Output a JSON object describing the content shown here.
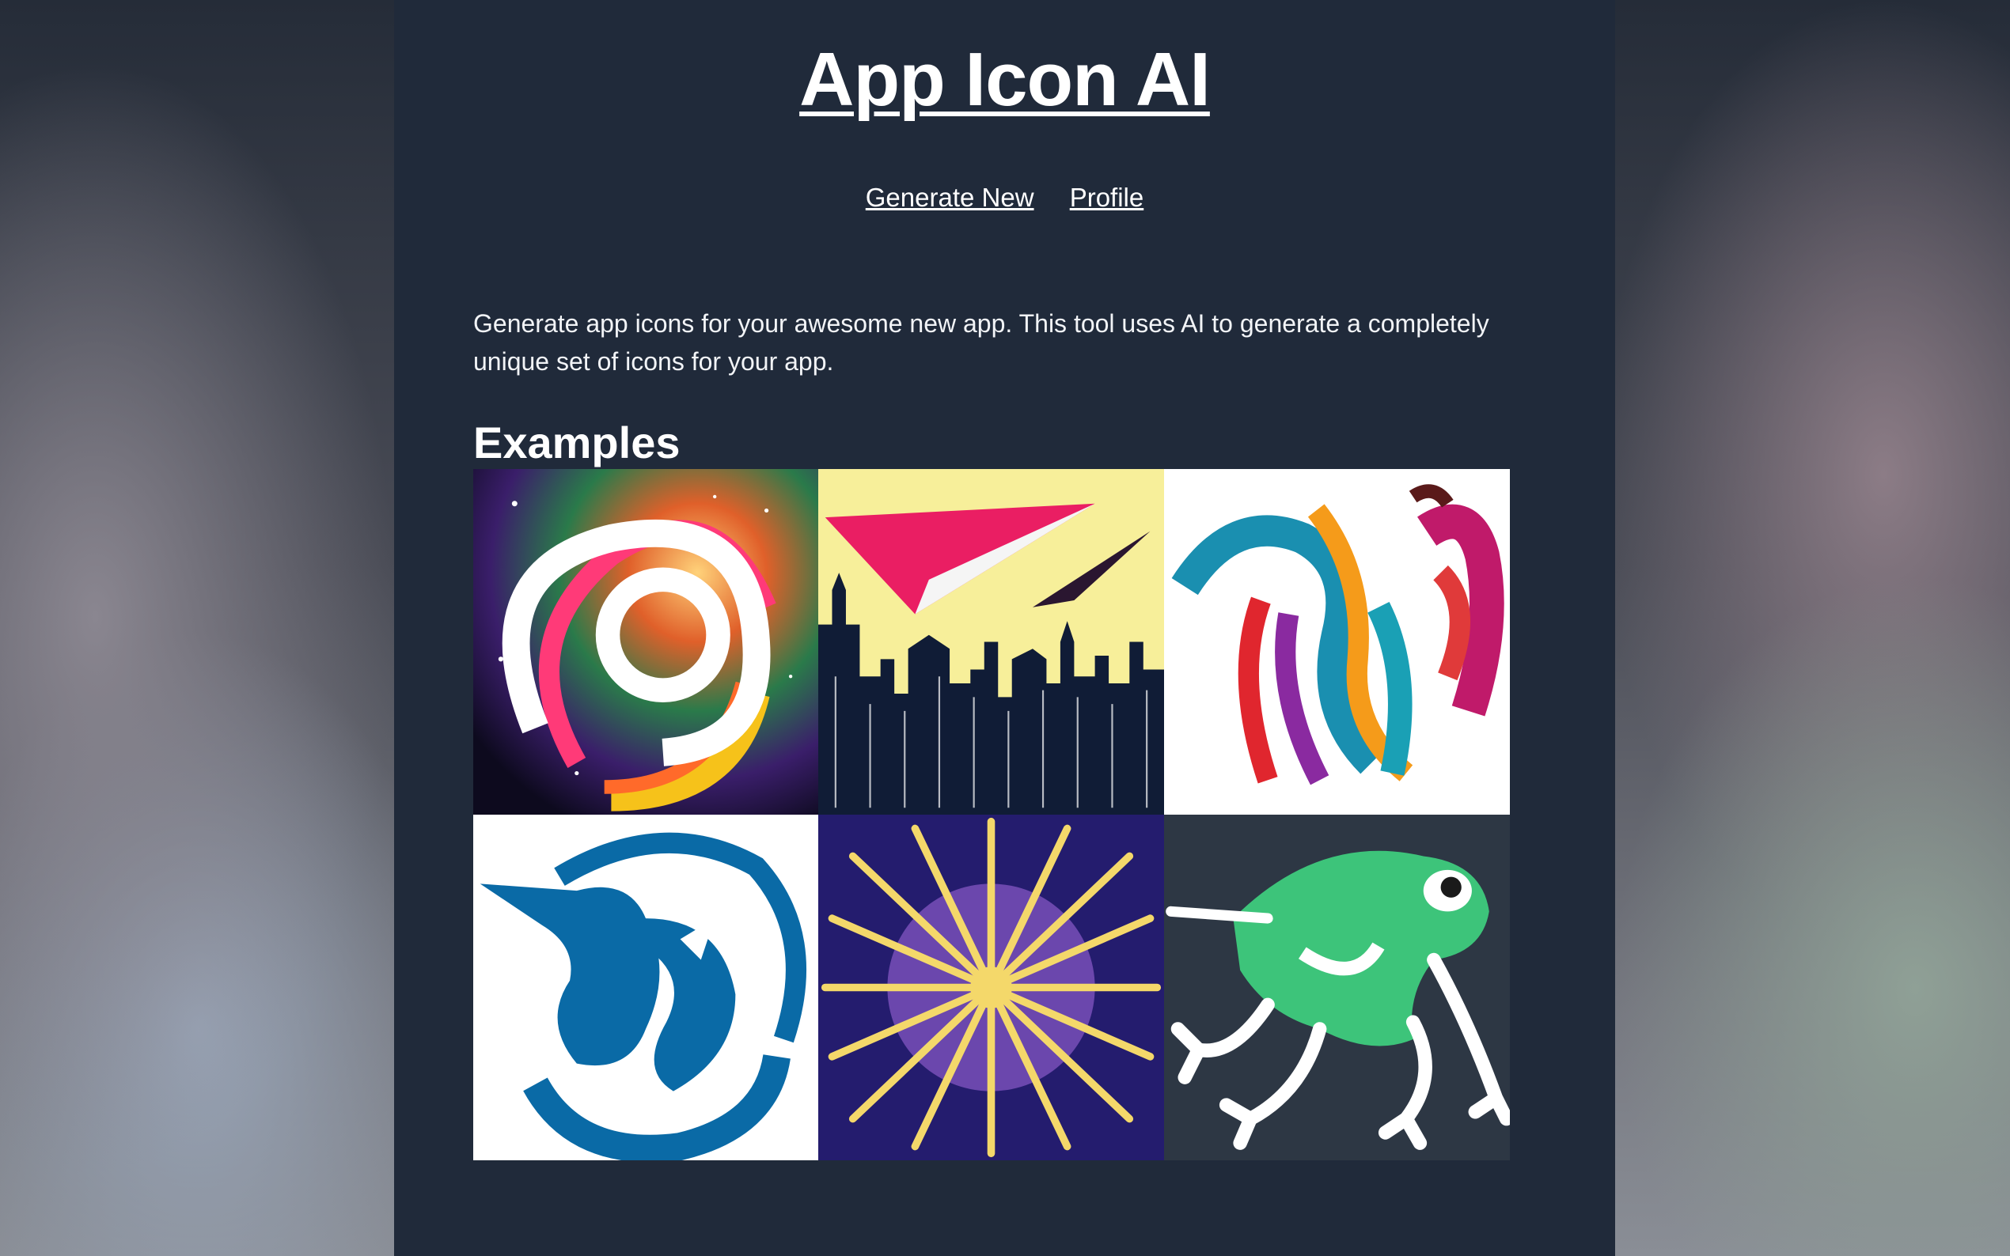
{
  "header": {
    "title": "App Icon AI"
  },
  "nav": {
    "generate_new": "Generate New",
    "profile": "Profile"
  },
  "main": {
    "intro": "Generate app icons for your awesome new app. This tool uses AI to generate a completely unique set of icons for your app.",
    "examples_heading": "Examples",
    "examples": [
      {
        "icon": "galaxy-swirl-icon",
        "bg": "#141028"
      },
      {
        "icon": "city-paper-plane-icon",
        "bg": "#f7ef9a"
      },
      {
        "icon": "colorful-horse-icon",
        "bg": "#ffffff"
      },
      {
        "icon": "blue-bird-swirl-icon",
        "bg": "#ffffff"
      },
      {
        "icon": "firework-burst-icon",
        "bg": "#241c6e"
      },
      {
        "icon": "green-frog-icon",
        "bg": "#2d3744"
      }
    ]
  },
  "colors": {
    "page_bg": "#202a3a",
    "text": "#ffffff"
  }
}
